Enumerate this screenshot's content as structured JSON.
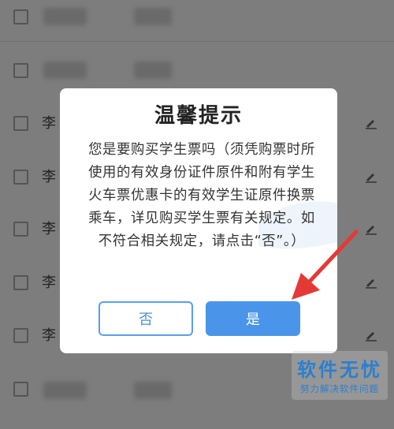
{
  "list": {
    "rows": [
      {
        "name": ""
      },
      {
        "name": ""
      },
      {
        "name": "李"
      },
      {
        "name": "李"
      },
      {
        "name": "李"
      },
      {
        "name": "李"
      },
      {
        "name": "李"
      },
      {
        "name": ""
      }
    ]
  },
  "dialog": {
    "title": "温馨提示",
    "message": "您是要购买学生票吗（须凭购票时所使用的有效身份证件原件和附有学生火车票优惠卡的有效学生证原件换票乘车，详见购买学生票有关规定。如不符合相关规定，请点击“否”。）",
    "no_label": "否",
    "yes_label": "是"
  },
  "watermark": {
    "title": "软件无忧",
    "subtitle": "努力解决软件问题"
  },
  "colors": {
    "overlay": "#7d7d7d",
    "accent": "#4a95ea",
    "arrow": "#e53935",
    "watermark": "#2a7fd0"
  }
}
